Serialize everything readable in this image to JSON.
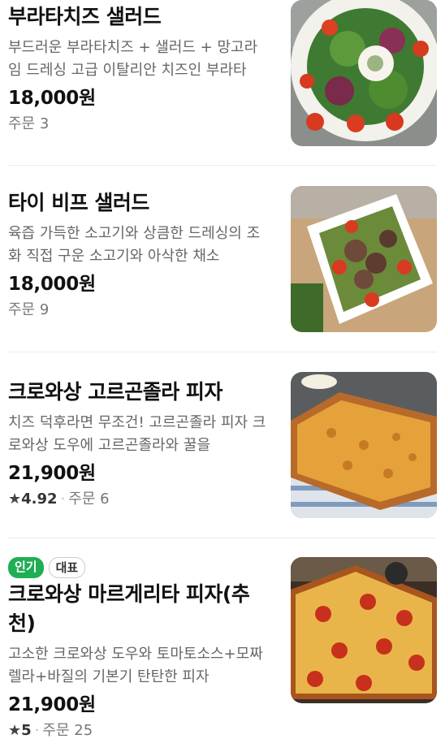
{
  "menu_items": [
    {
      "title": "부라타치즈 샐러드",
      "description": "부드러운 부라타치즈 + 샐러드 + 망고라임 드레싱 고급 이탈리안 치즈인 부라타",
      "price": "18,000원",
      "orders_label": "주문",
      "orders": "3",
      "image_icon": "burrata-salad-photo"
    },
    {
      "title": "타이 비프 샐러드",
      "description": "육즙 가득한 소고기와 상큼한 드레싱의 조화 직접 구운 소고기와 아삭한 채소",
      "price": "18,000원",
      "orders_label": "주문",
      "orders": "9",
      "image_icon": "beef-salad-photo"
    },
    {
      "title": "크로와상 고르곤졸라 피자",
      "description": "치즈 덕후라면 무조건! 고르곤졸라 피자 크로와상 도우에 고르곤졸라와 꿀을",
      "price": "21,900원",
      "star": "★",
      "rating": "4.92",
      "orders_label": "주문",
      "orders": "6",
      "image_icon": "gorgonzola-pizza-photo"
    },
    {
      "badges": [
        "인기",
        "대표"
      ],
      "title": "크로와상 마르게리타 피자(추천)",
      "description": "고소한 크로와상 도우와 토마토소스+모짜렐라+바질의 기본기 탄탄한 피자",
      "price": "21,900원",
      "star": "★",
      "rating": "5",
      "orders_label": "주문",
      "orders": "25",
      "image_icon": "margherita-pizza-photo"
    }
  ],
  "colors": {
    "popular_badge": "#1fae54",
    "text_primary": "#111111",
    "text_secondary": "#666666",
    "separator": "#ececec"
  }
}
